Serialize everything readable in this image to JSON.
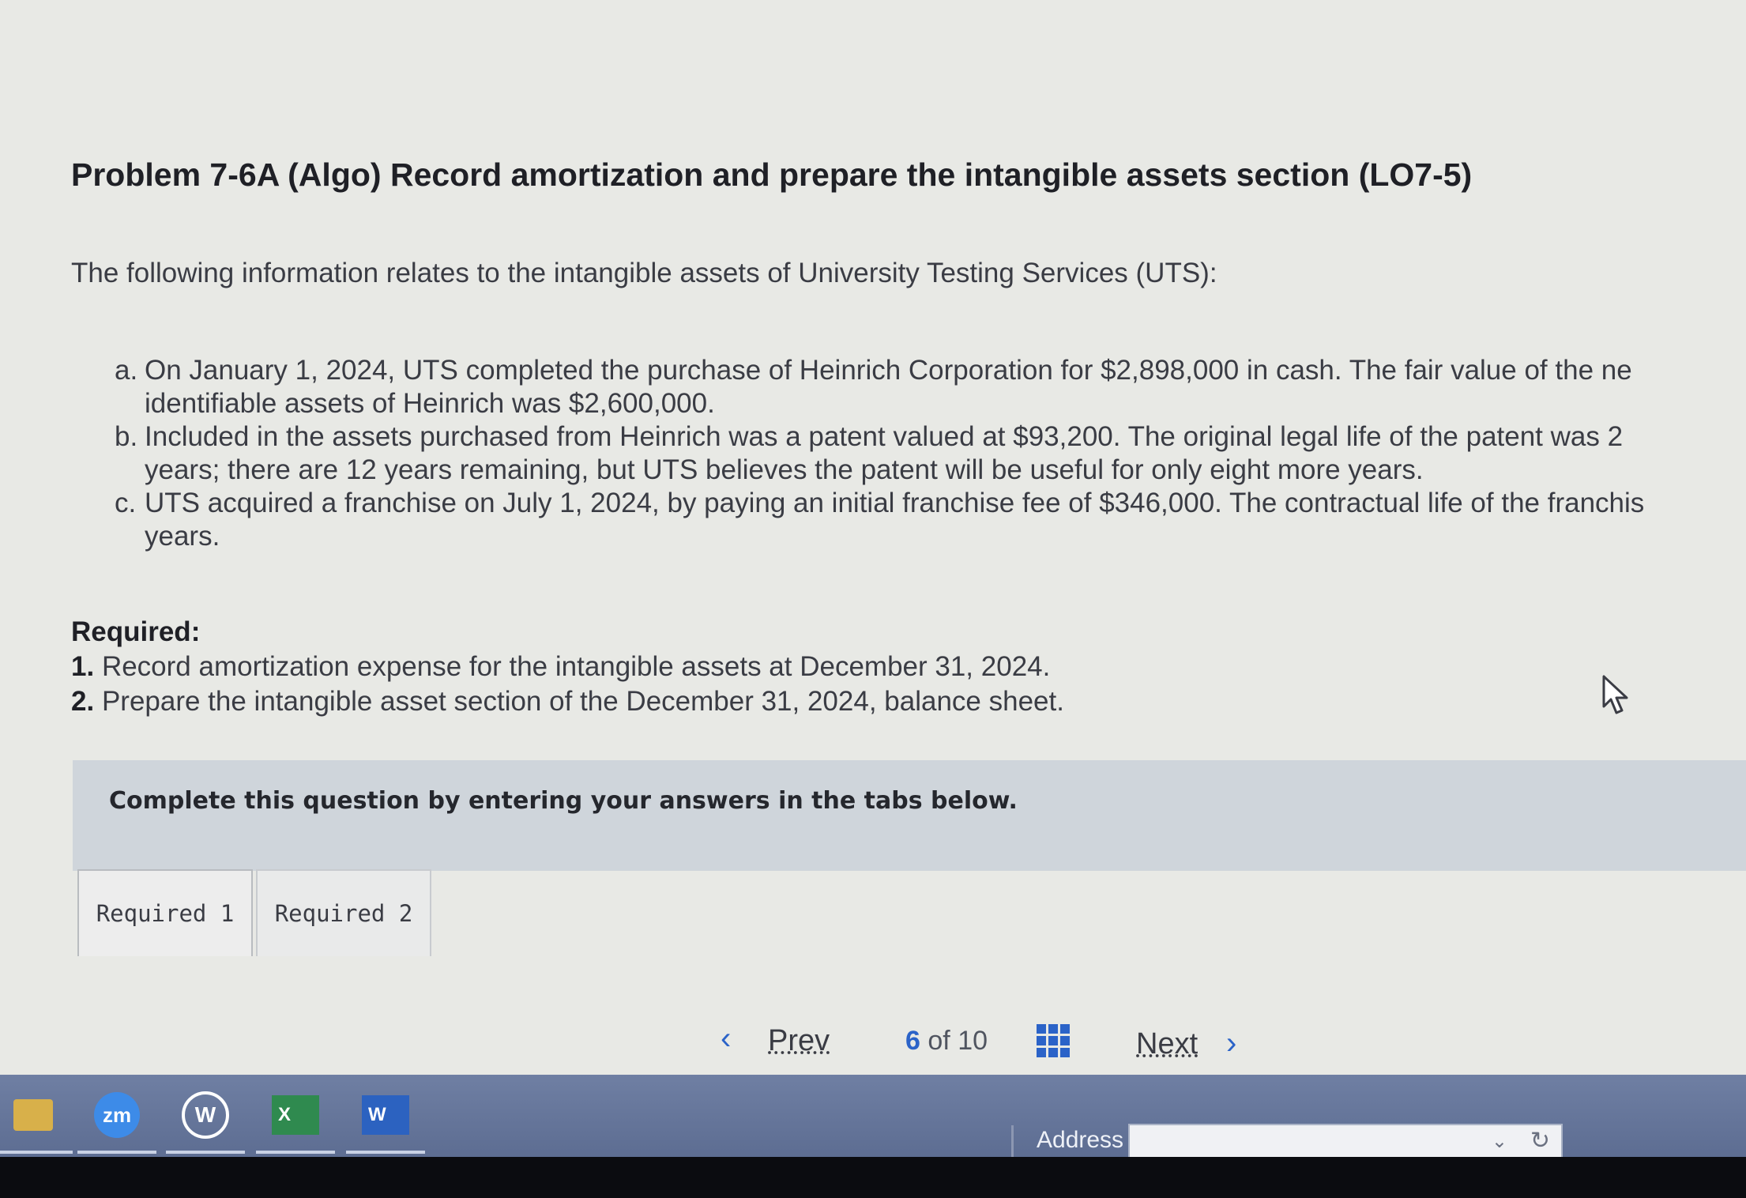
{
  "problem": {
    "title": "Problem 7-6A (Algo) Record amortization and prepare the intangible assets section (LO7-5)",
    "intro": "The following information relates to the intangible assets of University Testing Services (UTS):",
    "items": [
      {
        "marker": "a.",
        "lines": [
          "On January 1, 2024, UTS completed the purchase of Heinrich Corporation for $2,898,000 in cash. The fair value of the ne",
          "identifiable assets of Heinrich was $2,600,000."
        ]
      },
      {
        "marker": "b.",
        "lines": [
          "Included in the assets purchased from Heinrich was a patent valued at $93,200. The original legal life of the patent was 2",
          "years; there are 12 years remaining, but UTS believes the patent will be useful for only eight more years."
        ]
      },
      {
        "marker": "c.",
        "lines": [
          "UTS acquired a franchise on July 1, 2024, by paying an initial franchise fee of $346,000. The contractual life of the franchis",
          "years."
        ]
      }
    ],
    "required_heading": "Required:",
    "required": [
      {
        "num": "1.",
        "text": "Record amortization expense for the intangible assets at December 31, 2024."
      },
      {
        "num": "2.",
        "text": "Prepare the intangible asset section of the December 31, 2024, balance sheet."
      }
    ]
  },
  "banner": {
    "text": "Complete this question by entering your answers in the tabs below."
  },
  "tabs": [
    {
      "label": "Required 1"
    },
    {
      "label": "Required 2"
    }
  ],
  "pager": {
    "prev_label": "Prev",
    "current": "6",
    "of_text": "of",
    "total": "10",
    "next_label": "Next"
  },
  "taskbar": {
    "address_label": "Address",
    "zoom_icon_text": "zm",
    "wiki_icon_text": "W",
    "excel_icon_text": "X",
    "word_icon_text": "W"
  },
  "colors": {
    "accent": "#2b63c8",
    "banner": "#cfd5db",
    "taskbar": "#6575a0"
  }
}
